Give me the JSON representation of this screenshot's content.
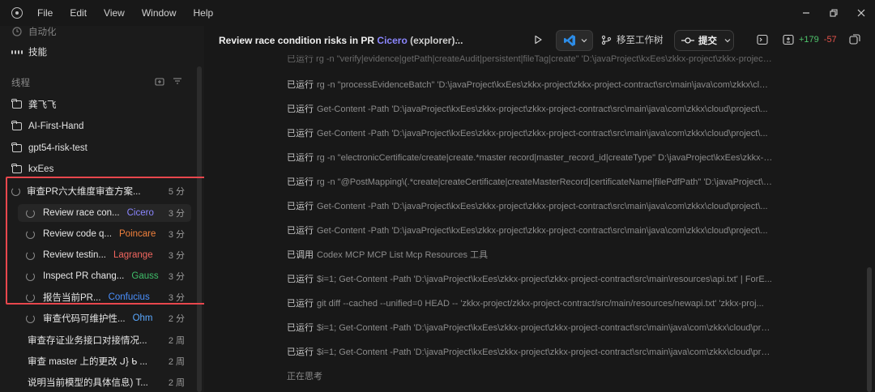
{
  "menubar": {
    "items": [
      "File",
      "Edit",
      "View",
      "Window",
      "Help"
    ]
  },
  "sidebar": {
    "top_partial_label": "自动化",
    "skills_label": "技能",
    "threads_title": "线程",
    "folders": [
      "龚飞飞",
      "AI-First-Hand",
      "gpt54-risk-test",
      "kxEes"
    ],
    "parent_thread": {
      "title": "审查PR六大维度审查方案...",
      "time": "5 分"
    },
    "subagents": [
      {
        "title": "Review race con...",
        "agent": "Cicero",
        "agent_color": "#8b86ff",
        "time": "3 分",
        "active": true
      },
      {
        "title": "Review code q...",
        "agent": "Poincare",
        "agent_color": "#f0803c",
        "time": "3 分"
      },
      {
        "title": "Review testin...",
        "agent": "Lagrange",
        "agent_color": "#f2665f",
        "time": "3 分"
      },
      {
        "title": "Inspect PR chang...",
        "agent": "Gauss",
        "agent_color": "#3fbf6a",
        "time": "3 分"
      },
      {
        "title": "报告当前PR...",
        "agent": "Confucius",
        "agent_color": "#4a90ff",
        "time": "3 分"
      },
      {
        "title": "审查代码可维护性...",
        "agent": "Ohm",
        "agent_color": "#5aa8ff",
        "time": "2 分"
      }
    ],
    "other_threads": [
      {
        "title": "审查存证业务接口对接情况...",
        "time": "2 周"
      },
      {
        "title": "审查 master 上的更改 ᒍ} ᑲ ...",
        "time": "2 周"
      },
      {
        "title": "说明当前模型的具体信息) T...",
        "time": "2 周"
      }
    ]
  },
  "header": {
    "title_prefix": "Review race condition risks in PR",
    "agent": "Cicero",
    "role": "(explorer)...",
    "move_label": "移至工作树",
    "commit_label": "提交",
    "diff_add": "+179",
    "diff_del": "-57"
  },
  "log": {
    "cut_line": "已运行 rg -n \"verify|evidence|getPath|createAudit|persistent|fileTag|create\" 'D:\\javaProject\\kxEes\\zkkx-project\\zkkx-project-contract\\...",
    "lines": [
      {
        "verb": "已运行",
        "text": "rg -n \"processEvidenceBatch\" 'D:\\javaProject\\kxEes\\zkkx-project\\zkkx-project-contract\\src\\main\\java\\com\\zkkx\\cloud\\..."
      },
      {
        "verb": "已运行",
        "text": "Get-Content -Path 'D:\\javaProject\\kxEes\\zkkx-project\\zkkx-project-contract\\src\\main\\java\\com\\zkkx\\cloud\\project\\..."
      },
      {
        "verb": "已运行",
        "text": "Get-Content -Path 'D:\\javaProject\\kxEes\\zkkx-project\\zkkx-project-contract\\src\\main\\java\\com\\zkkx\\cloud\\project\\..."
      },
      {
        "verb": "已运行",
        "text": "rg -n \"electronicCertificate/create|create.*master record|master_record_id|createType\" D:\\javaProject\\kxEes\\zkkx-pr..."
      },
      {
        "verb": "已运行",
        "text": "rg -n \"@PostMapping\\(.*create|createCertificate|createMasterRecord|certificateName|filePdfPath\" 'D:\\javaProject\\kx..."
      },
      {
        "verb": "已运行",
        "text": "Get-Content -Path 'D:\\javaProject\\kxEes\\zkkx-project\\zkkx-project-contract\\src\\main\\java\\com\\zkkx\\cloud\\project\\..."
      },
      {
        "verb": "已运行",
        "text": "Get-Content -Path 'D:\\javaProject\\kxEes\\zkkx-project\\zkkx-project-contract\\src\\main\\java\\com\\zkkx\\cloud\\project\\..."
      },
      {
        "verb": "已调用",
        "text": "Codex MCP MCP List Mcp Resources 工具"
      },
      {
        "verb": "已运行",
        "text": "$i=1; Get-Content -Path 'D:\\javaProject\\kxEes\\zkkx-project\\zkkx-project-contract\\src\\main\\resources\\api.txt' | ForE..."
      },
      {
        "verb": "已运行",
        "text": "git diff --cached --unified=0 HEAD -- 'zkkx-project/zkkx-project-contract/src/main/resources/newapi.txt' 'zkkx-proj..."
      },
      {
        "verb": "已运行",
        "text": "$i=1; Get-Content -Path 'D:\\javaProject\\kxEes\\zkkx-project\\zkkx-project-contract\\src\\main\\java\\com\\zkkx\\cloud\\project\\..."
      },
      {
        "verb": "已运行",
        "text": "$i=1; Get-Content -Path 'D:\\javaProject\\kxEes\\zkkx-project\\zkkx-project-contract\\src\\main\\java\\com\\zkkx\\cloud\\project\\..."
      }
    ],
    "thinking": "正在思考"
  }
}
